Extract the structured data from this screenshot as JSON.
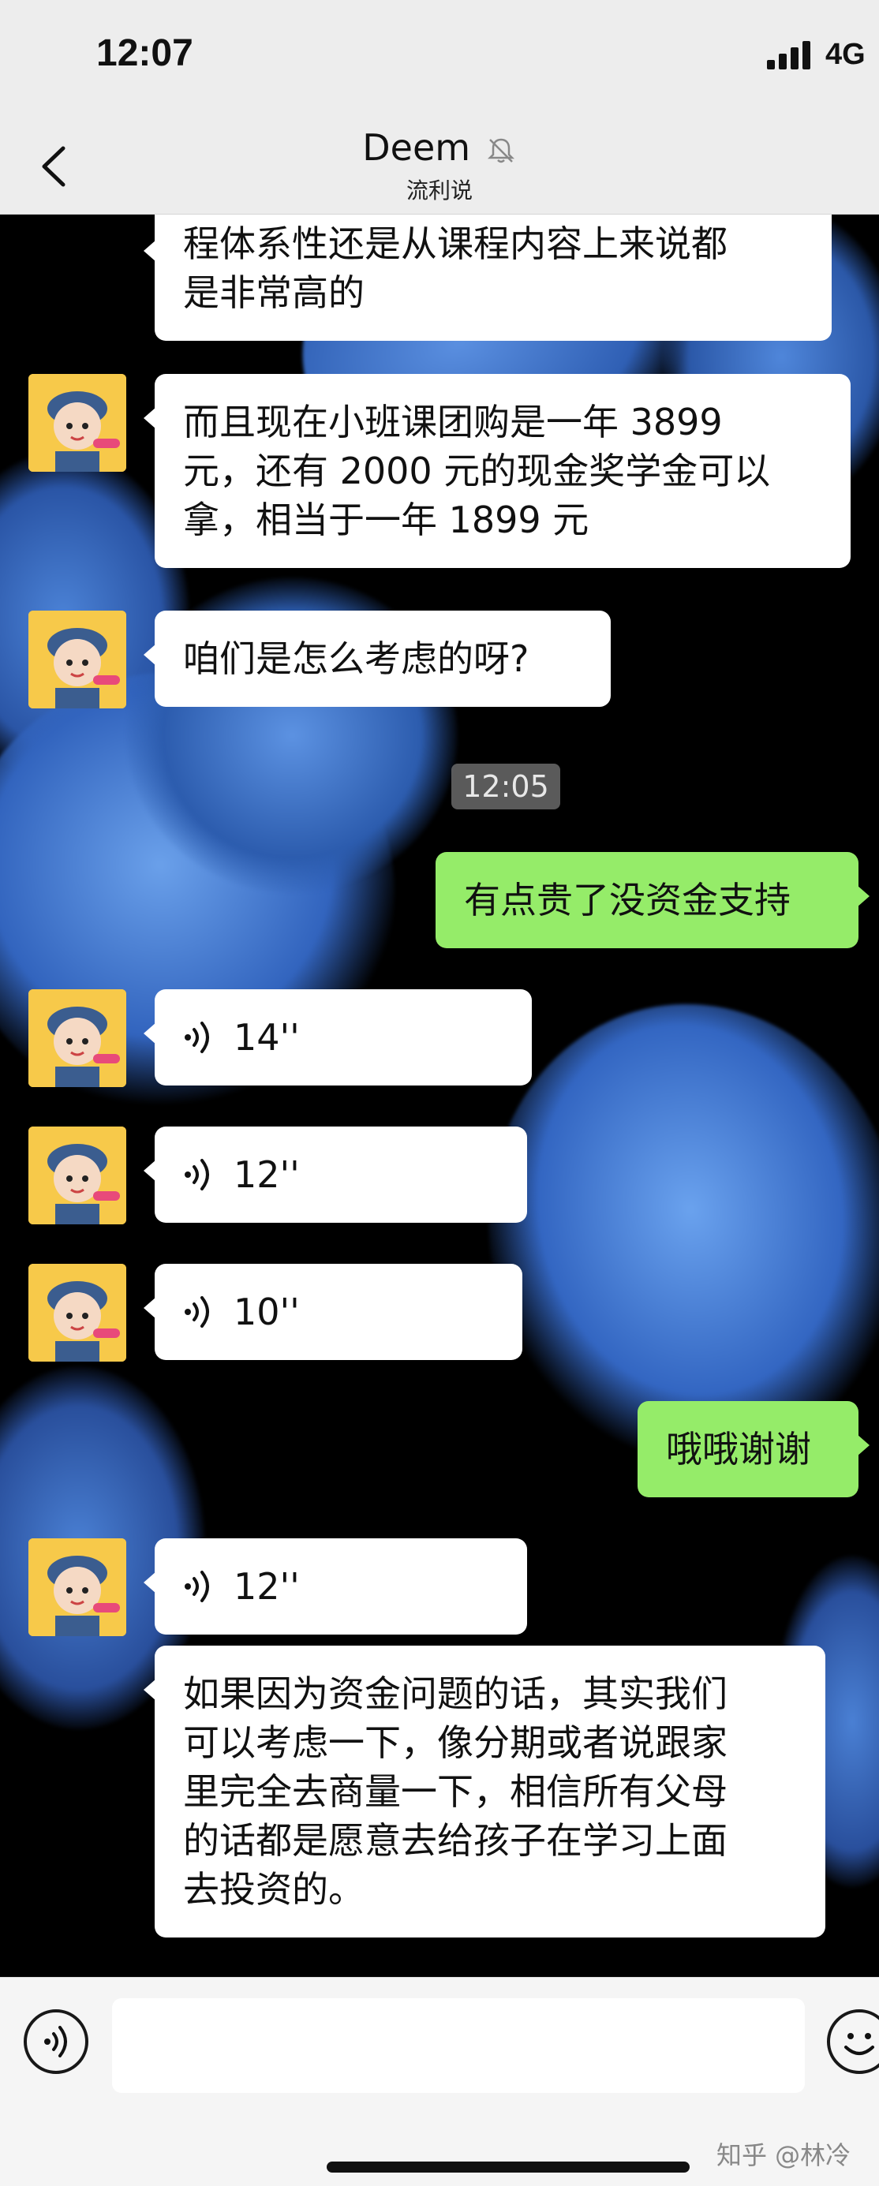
{
  "status_bar": {
    "time": "12:07",
    "network": "4G"
  },
  "nav": {
    "title": "Deem",
    "subtitle": "流利说",
    "back_icon": "chevron-left-icon",
    "mute_icon": "bell-off-icon"
  },
  "messages": [
    {
      "id": "m0",
      "side": "left",
      "type": "text",
      "lines": [
        "程体系性还是从课程内容上来说都",
        "是非常高的"
      ]
    },
    {
      "id": "m1",
      "side": "left",
      "type": "text",
      "lines": [
        "而且现在小班课团购是一年 3899",
        "元，还有 2000 元的现金奖学金可以",
        "拿，相当于一年 1899 元"
      ]
    },
    {
      "id": "m2",
      "side": "left",
      "type": "text",
      "lines": [
        "咱们是怎么考虑的呀?"
      ]
    },
    {
      "id": "ts",
      "type": "timestamp",
      "text": "12:05"
    },
    {
      "id": "m3",
      "side": "right",
      "type": "text",
      "lines": [
        "有点贵了没资金支持"
      ]
    },
    {
      "id": "m4",
      "side": "left",
      "type": "voice",
      "duration": "14''"
    },
    {
      "id": "m5",
      "side": "left",
      "type": "voice",
      "duration": "12''"
    },
    {
      "id": "m6",
      "side": "left",
      "type": "voice",
      "duration": "10''"
    },
    {
      "id": "m7",
      "side": "right",
      "type": "text",
      "lines": [
        "哦哦谢谢"
      ]
    },
    {
      "id": "m8",
      "side": "left",
      "type": "voice",
      "duration": "12''"
    },
    {
      "id": "m9",
      "side": "left",
      "type": "text",
      "lines": [
        "如果因为资金问题的话，其实我们",
        "可以考虑一下，像分期或者说跟家",
        "里完全去商量一下，相信所有父母",
        "的话都是愿意去给孩子在学习上面",
        "去投资的。"
      ]
    }
  ],
  "input_bar": {
    "voice_icon": "voice-input-icon",
    "emoji_icon": "emoji-icon",
    "placeholder": ""
  },
  "watermark": "知乎 @林冷",
  "colors": {
    "bubble_self": "#95ec69",
    "bubble_other": "#ffffff",
    "nav_bg": "#ededed",
    "avatar_bg": "#f7c94a"
  }
}
